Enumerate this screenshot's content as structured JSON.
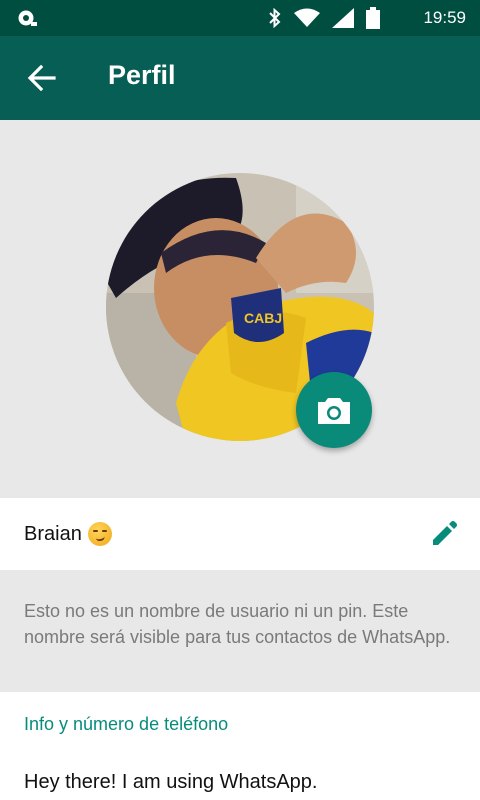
{
  "status_bar": {
    "time": "19:59",
    "icons": [
      "notification-icon",
      "bluetooth-icon",
      "wifi-icon",
      "signal-icon",
      "battery-icon"
    ]
  },
  "app_bar": {
    "title": "Perfil",
    "back_icon": "arrow-back-icon"
  },
  "profile": {
    "camera_icon": "camera-icon",
    "name": "Braian",
    "name_emoji": "smirk-emoji",
    "edit_icon": "pencil-icon",
    "hint": "Esto no es un nombre de usuario ni un pin. Este nombre será visible para tus contactos de WhatsApp."
  },
  "info": {
    "section_title": "Info y número de teléfono",
    "about": "Hey there! I am using WhatsApp."
  },
  "colors": {
    "status_bar": "#004e40",
    "app_bar": "#075e54",
    "accent": "#0a8a78",
    "section_title": "#078c7c"
  }
}
